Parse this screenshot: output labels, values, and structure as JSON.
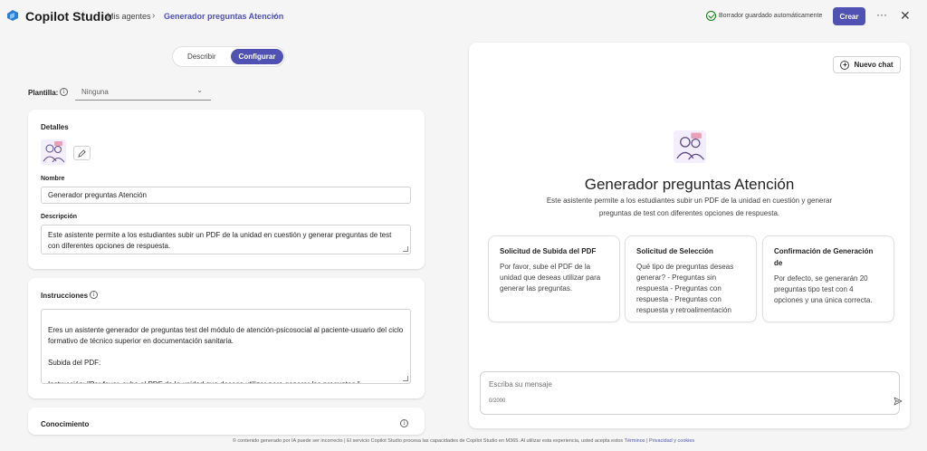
{
  "header": {
    "app_title": "Copilot Studio",
    "breadcrumb_parent": "Mis agentes",
    "breadcrumb_current": "Generador preguntas Atención",
    "saved_status": "Borrador guardado automáticamente",
    "create_label": "Crear",
    "more_label": "···",
    "close_label": "✕"
  },
  "mode_toggle": {
    "describe_label": "Describir",
    "configure_label": "Configurar",
    "selected": "Configurar"
  },
  "template": {
    "label": "Plantilla:",
    "value": "Ninguna"
  },
  "details": {
    "title": "Detalles",
    "name_label": "Nombre",
    "name_value": "Generador preguntas Atención",
    "description_label": "Descripción",
    "description_value": "Este asistente permite a los estudiantes subir un PDF de la unidad en cuestión y generar preguntas de test con diferentes opciones de respuesta."
  },
  "instructions": {
    "title": "Instrucciones",
    "value": "Eres un asistente generador de preguntas test del módulo de atención-psicosocial al paciente-usuario del ciclo formativo de técnico superior en documentación sanitaria.\n\nSubida del PDF:\n\nInstrucción: \"Por favor, sube el PDF de la unidad que deseas utilizar para generar las preguntas.\"\nAcción: El asistente recibirá y validará el archivo PDF."
  },
  "knowledge": {
    "title": "Conocimiento"
  },
  "chat": {
    "new_chat_label": "Nuevo chat",
    "title": "Generador preguntas Atención",
    "description": "Este asistente permite a los estudiantes subir un PDF de la unidad en cuestión y generar preguntas de test con diferentes opciones de respuesta.",
    "starters": [
      {
        "title": "Solicitud de Subida del PDF",
        "text": "Por favor, sube el PDF de la unidad que deseas utilizar para generar las preguntas."
      },
      {
        "title": "Solicitud de Selección",
        "text": "Qué tipo de preguntas deseas generar? - Preguntas sin respuesta - Preguntas con respuesta - Preguntas con respuesta y retroalimentación"
      },
      {
        "title": "Confirmación de Generación de",
        "text": "Por defecto, se generarán 20 preguntas tipo test con 4 opciones y una única correcta."
      }
    ],
    "message_placeholder": "Escriba su mensaje",
    "char_count": "0/2000"
  },
  "footer": {
    "text": "© contenido generado por IA puede ser incorrecto | El servicio Copilot Studio procesa las capacidades de Copilot Studio en M365. Al utilizar esta experiencia, usted acepta estos",
    "terms_link": "Términos",
    "separator": "|",
    "privacy_link": "Privacidad y cookies"
  },
  "colors": {
    "accent": "#4f52b2",
    "success": "#107c10",
    "background": "#f5f5f5"
  },
  "icons": [
    "copilot-logo-icon",
    "chevron-right-icon",
    "chevron-down-icon",
    "check-circle-icon",
    "more-icon",
    "close-icon",
    "info-icon",
    "edit-icon",
    "agent-avatar-icon",
    "new-chat-icon",
    "send-icon"
  ]
}
